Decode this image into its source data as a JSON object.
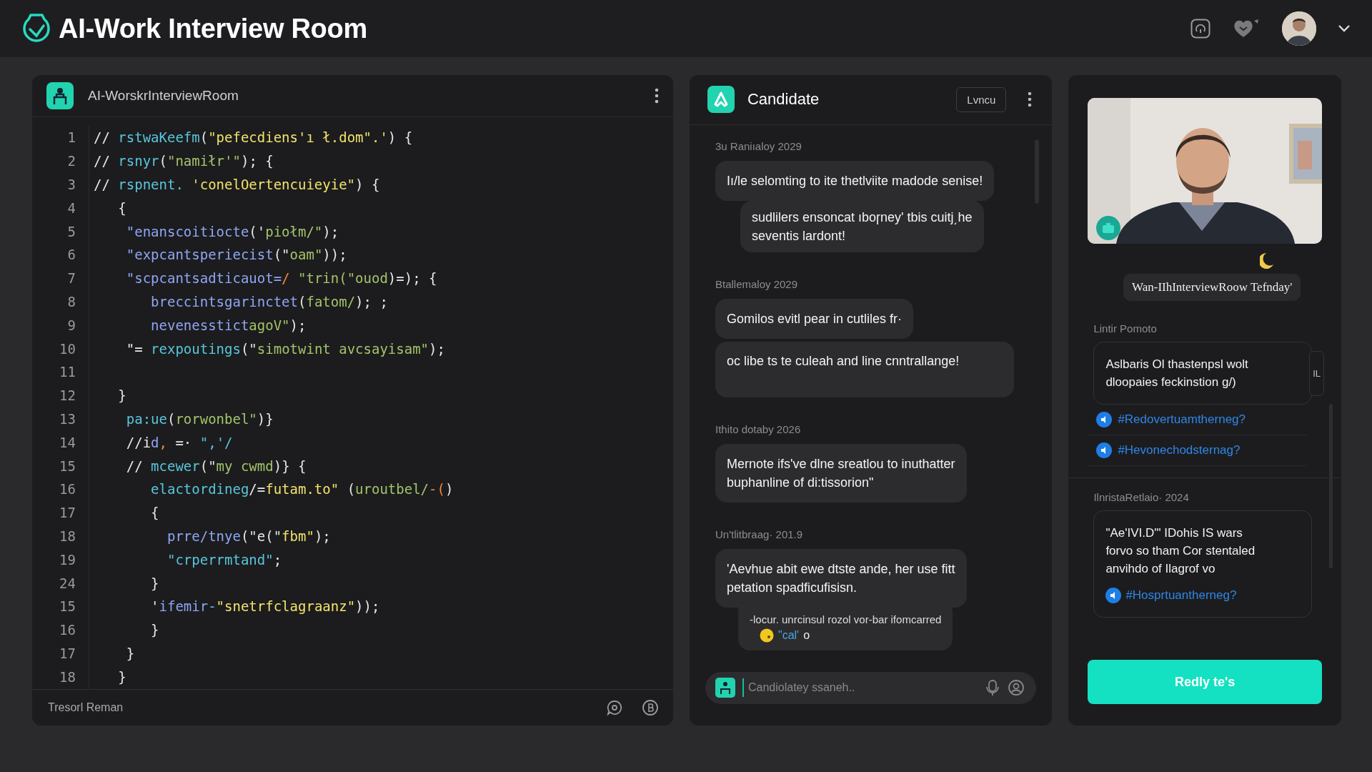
{
  "app": {
    "title": "AI-Work Interview Room"
  },
  "editor": {
    "title": "AI-WorskrInterviewRoom",
    "footer": "Tresorl Reman",
    "lines": [
      {
        "number": "1",
        "tokens": [
          {
            "text": "// ",
            "kind": "plain"
          },
          {
            "text": "rstwaKeefm",
            "kind": "fn"
          },
          {
            "text": "(",
            "kind": "plain"
          },
          {
            "text": "\"pefecdiens'ı ł.dom\".'",
            "kind": "lit"
          },
          {
            "text": ") {",
            "kind": "plain"
          }
        ]
      },
      {
        "number": "2",
        "tokens": [
          {
            "text": "// ",
            "kind": "plain"
          },
          {
            "text": "rsnyr",
            "kind": "fn"
          },
          {
            "text": "(",
            "kind": "plain"
          },
          {
            "text": "\"namiłr'\"",
            "kind": "str"
          },
          {
            "text": "); {",
            "kind": "plain"
          }
        ]
      },
      {
        "number": "3",
        "tokens": [
          {
            "text": "// ",
            "kind": "plain"
          },
          {
            "text": "rspnent.",
            "kind": "fn"
          },
          {
            "text": " 'conelOertencuieyie\"",
            "kind": "lit"
          },
          {
            "text": ") {",
            "kind": "plain"
          }
        ]
      },
      {
        "number": "4",
        "tokens": [
          {
            "text": "   {",
            "kind": "plain"
          }
        ]
      },
      {
        "number": "5",
        "tokens": [
          {
            "text": "    \"enanscoitiocte",
            "kind": "call"
          },
          {
            "text": "('",
            "kind": "plain"
          },
          {
            "text": "piołm/\"",
            "kind": "str"
          },
          {
            "text": ");",
            "kind": "plain"
          }
        ]
      },
      {
        "number": "6",
        "tokens": [
          {
            "text": "    \"expcantsperiecist",
            "kind": "call"
          },
          {
            "text": "(\"",
            "kind": "plain"
          },
          {
            "text": "oam\"",
            "kind": "str"
          },
          {
            "text": "));",
            "kind": "plain"
          }
        ]
      },
      {
        "number": "7",
        "tokens": [
          {
            "text": "    \"scpcantsadticauot=",
            "kind": "call"
          },
          {
            "text": "/",
            "kind": "op"
          },
          {
            "text": " \"trin(\"ouod",
            "kind": "str"
          },
          {
            "text": ")=); {",
            "kind": "plain"
          }
        ]
      },
      {
        "number": "8",
        "tokens": [
          {
            "text": "       breccintsgarinctet",
            "kind": "call"
          },
          {
            "text": "(",
            "kind": "plain"
          },
          {
            "text": "fatom/",
            "kind": "str"
          },
          {
            "text": "); ;",
            "kind": "plain"
          }
        ]
      },
      {
        "number": "9",
        "tokens": [
          {
            "text": "       nevenesstict",
            "kind": "call"
          },
          {
            "text": "agoV\"",
            "kind": "str"
          },
          {
            "text": ");",
            "kind": "plain"
          }
        ]
      },
      {
        "number": "10",
        "tokens": [
          {
            "text": "    \"= ",
            "kind": "plain"
          },
          {
            "text": "rexpoutings",
            "kind": "fn"
          },
          {
            "text": "(\"",
            "kind": "plain"
          },
          {
            "text": "simotwint avcsayisam\"",
            "kind": "str"
          },
          {
            "text": ");",
            "kind": "plain"
          }
        ]
      },
      {
        "number": "11"
      },
      {
        "number": "12",
        "tokens": [
          {
            "text": "   }",
            "kind": "plain"
          }
        ]
      },
      {
        "number": "13",
        "tokens": [
          {
            "text": "    pa:ue",
            "kind": "fn"
          },
          {
            "text": "(",
            "kind": "plain"
          },
          {
            "text": "rorwonbel\"",
            "kind": "str"
          },
          {
            "text": ")}",
            "kind": "plain"
          }
        ]
      },
      {
        "number": "14",
        "tokens": [
          {
            "text": "    //i",
            "kind": "plain"
          },
          {
            "text": "d",
            "kind": "call"
          },
          {
            "text": ",",
            "kind": "op"
          },
          {
            "text": " =· ",
            "kind": "plain"
          },
          {
            "text": "\",'/",
            "kind": "fn"
          }
        ]
      },
      {
        "number": "15",
        "tokens": [
          {
            "text": "    // ",
            "kind": "plain"
          },
          {
            "text": "mcewer",
            "kind": "fn"
          },
          {
            "text": "(\"",
            "kind": "plain"
          },
          {
            "text": "my cwmd",
            "kind": "str"
          },
          {
            "text": ")} {",
            "kind": "plain"
          }
        ]
      },
      {
        "number": "16",
        "tokens": [
          {
            "text": "       elactordineg",
            "kind": "fn"
          },
          {
            "text": "/=",
            "kind": "plain"
          },
          {
            "text": "futam.to\"",
            "kind": "lit"
          },
          {
            "text": " (",
            "kind": "plain"
          },
          {
            "text": "uroutbel/",
            "kind": "str"
          },
          {
            "text": "-(",
            "kind": "op"
          },
          {
            "text": ")",
            "kind": "plain"
          }
        ]
      },
      {
        "number": "17",
        "tokens": [
          {
            "text": "       {",
            "kind": "plain"
          }
        ]
      },
      {
        "number": "18",
        "tokens": [
          {
            "text": "         prre/tnye",
            "kind": "call"
          },
          {
            "text": "(\"e(\"",
            "kind": "plain"
          },
          {
            "text": "fbm\"",
            "kind": "lit"
          },
          {
            "text": ");",
            "kind": "plain"
          }
        ]
      },
      {
        "number": "19",
        "tokens": [
          {
            "text": "         \"crperrmtand\"",
            "kind": "fn"
          },
          {
            "text": ";",
            "kind": "plain"
          }
        ]
      },
      {
        "number": "24",
        "tokens": [
          {
            "text": "       }",
            "kind": "plain"
          }
        ]
      },
      {
        "number": "15",
        "tokens": [
          {
            "text": "       '",
            "kind": "plain"
          },
          {
            "text": "ifemir",
            "kind": "call"
          },
          {
            "text": "-",
            "kind": "fn"
          },
          {
            "text": "\"snetrfclagraanz\"",
            "kind": "lit"
          },
          {
            "text": "));",
            "kind": "plain"
          }
        ]
      },
      {
        "number": "16",
        "tokens": [
          {
            "text": "       }",
            "kind": "plain"
          }
        ]
      },
      {
        "number": "17",
        "tokens": [
          {
            "text": "    }",
            "kind": "plain"
          }
        ]
      },
      {
        "number": "18",
        "tokens": [
          {
            "text": "   }",
            "kind": "plain"
          }
        ]
      }
    ]
  },
  "chat": {
    "title": "Candidate",
    "button": "Lvncu",
    "composer": {
      "placeholder": "Candiolatey ssaneh.."
    },
    "groups": [
      {
        "date": "3u Raniıaloy 2029",
        "bubbles": [
          {
            "kind": "bubble",
            "lines": [
              "Iı/le selomting to ite thetlviite madode senise!"
            ]
          },
          {
            "kind": "reply",
            "lines": [
              "sudlilers ensoncat ıboɼney' tbis cuitj͵he",
              "seventis lardont!"
            ]
          }
        ]
      },
      {
        "date": "Btallemaloy 2029",
        "bubbles": [
          {
            "kind": "bubble",
            "lines": [
              "Gomilos evitl pear in cutliles fr·"
            ]
          },
          {
            "kind": "tall",
            "lines": [
              "oc libe ts te culeah and line cnntrallange!"
            ]
          }
        ]
      },
      {
        "date": "Ithito dotaby 2026",
        "bubbles": [
          {
            "kind": "bubble",
            "lines": [
              "Mernote ifs've dlne sreatlou to inuthatter",
              "buphanline of di:tissorion\""
            ]
          }
        ]
      },
      {
        "date": "Un'tlitbraag· 201.9",
        "bubbles": [
          {
            "kind": "bubble",
            "lines": [
              "'Aevhue abit ewe dtste ande, her use fitt",
              "petation spadficufisisn."
            ]
          },
          {
            "kind": "attachment",
            "lines": [
              "-locur. unrcinsul rozol vor-bar ifomcarred"
            ],
            "tag": "\"cal'",
            "tail": "o"
          }
        ]
      }
    ]
  },
  "side": {
    "session_label": "Wan-IIhInterviewRoow Tefnday'",
    "reply_button": "Redly te's",
    "sections": [
      {
        "heading": "Lintir Pomoto",
        "card": {
          "lines": [
            "Aslbaris Ol thastenpsl wolt",
            "dloopaies feckinstion g/)"
          ],
          "tab": "IL"
        },
        "links": [
          "#Redovertuamtherneg?",
          "#Hevonechodsternag?"
        ]
      },
      {
        "heading": "IlnristaRetlaio· 2024",
        "card": {
          "lines": [
            "\"Ae'IVI.D'\" IDohis IS wars",
            "forvo so tham Cor stentaled",
            "anvihdo of Ilagrof vo"
          ],
          "link": "#Hosprtuantherneg?"
        }
      }
    ]
  }
}
